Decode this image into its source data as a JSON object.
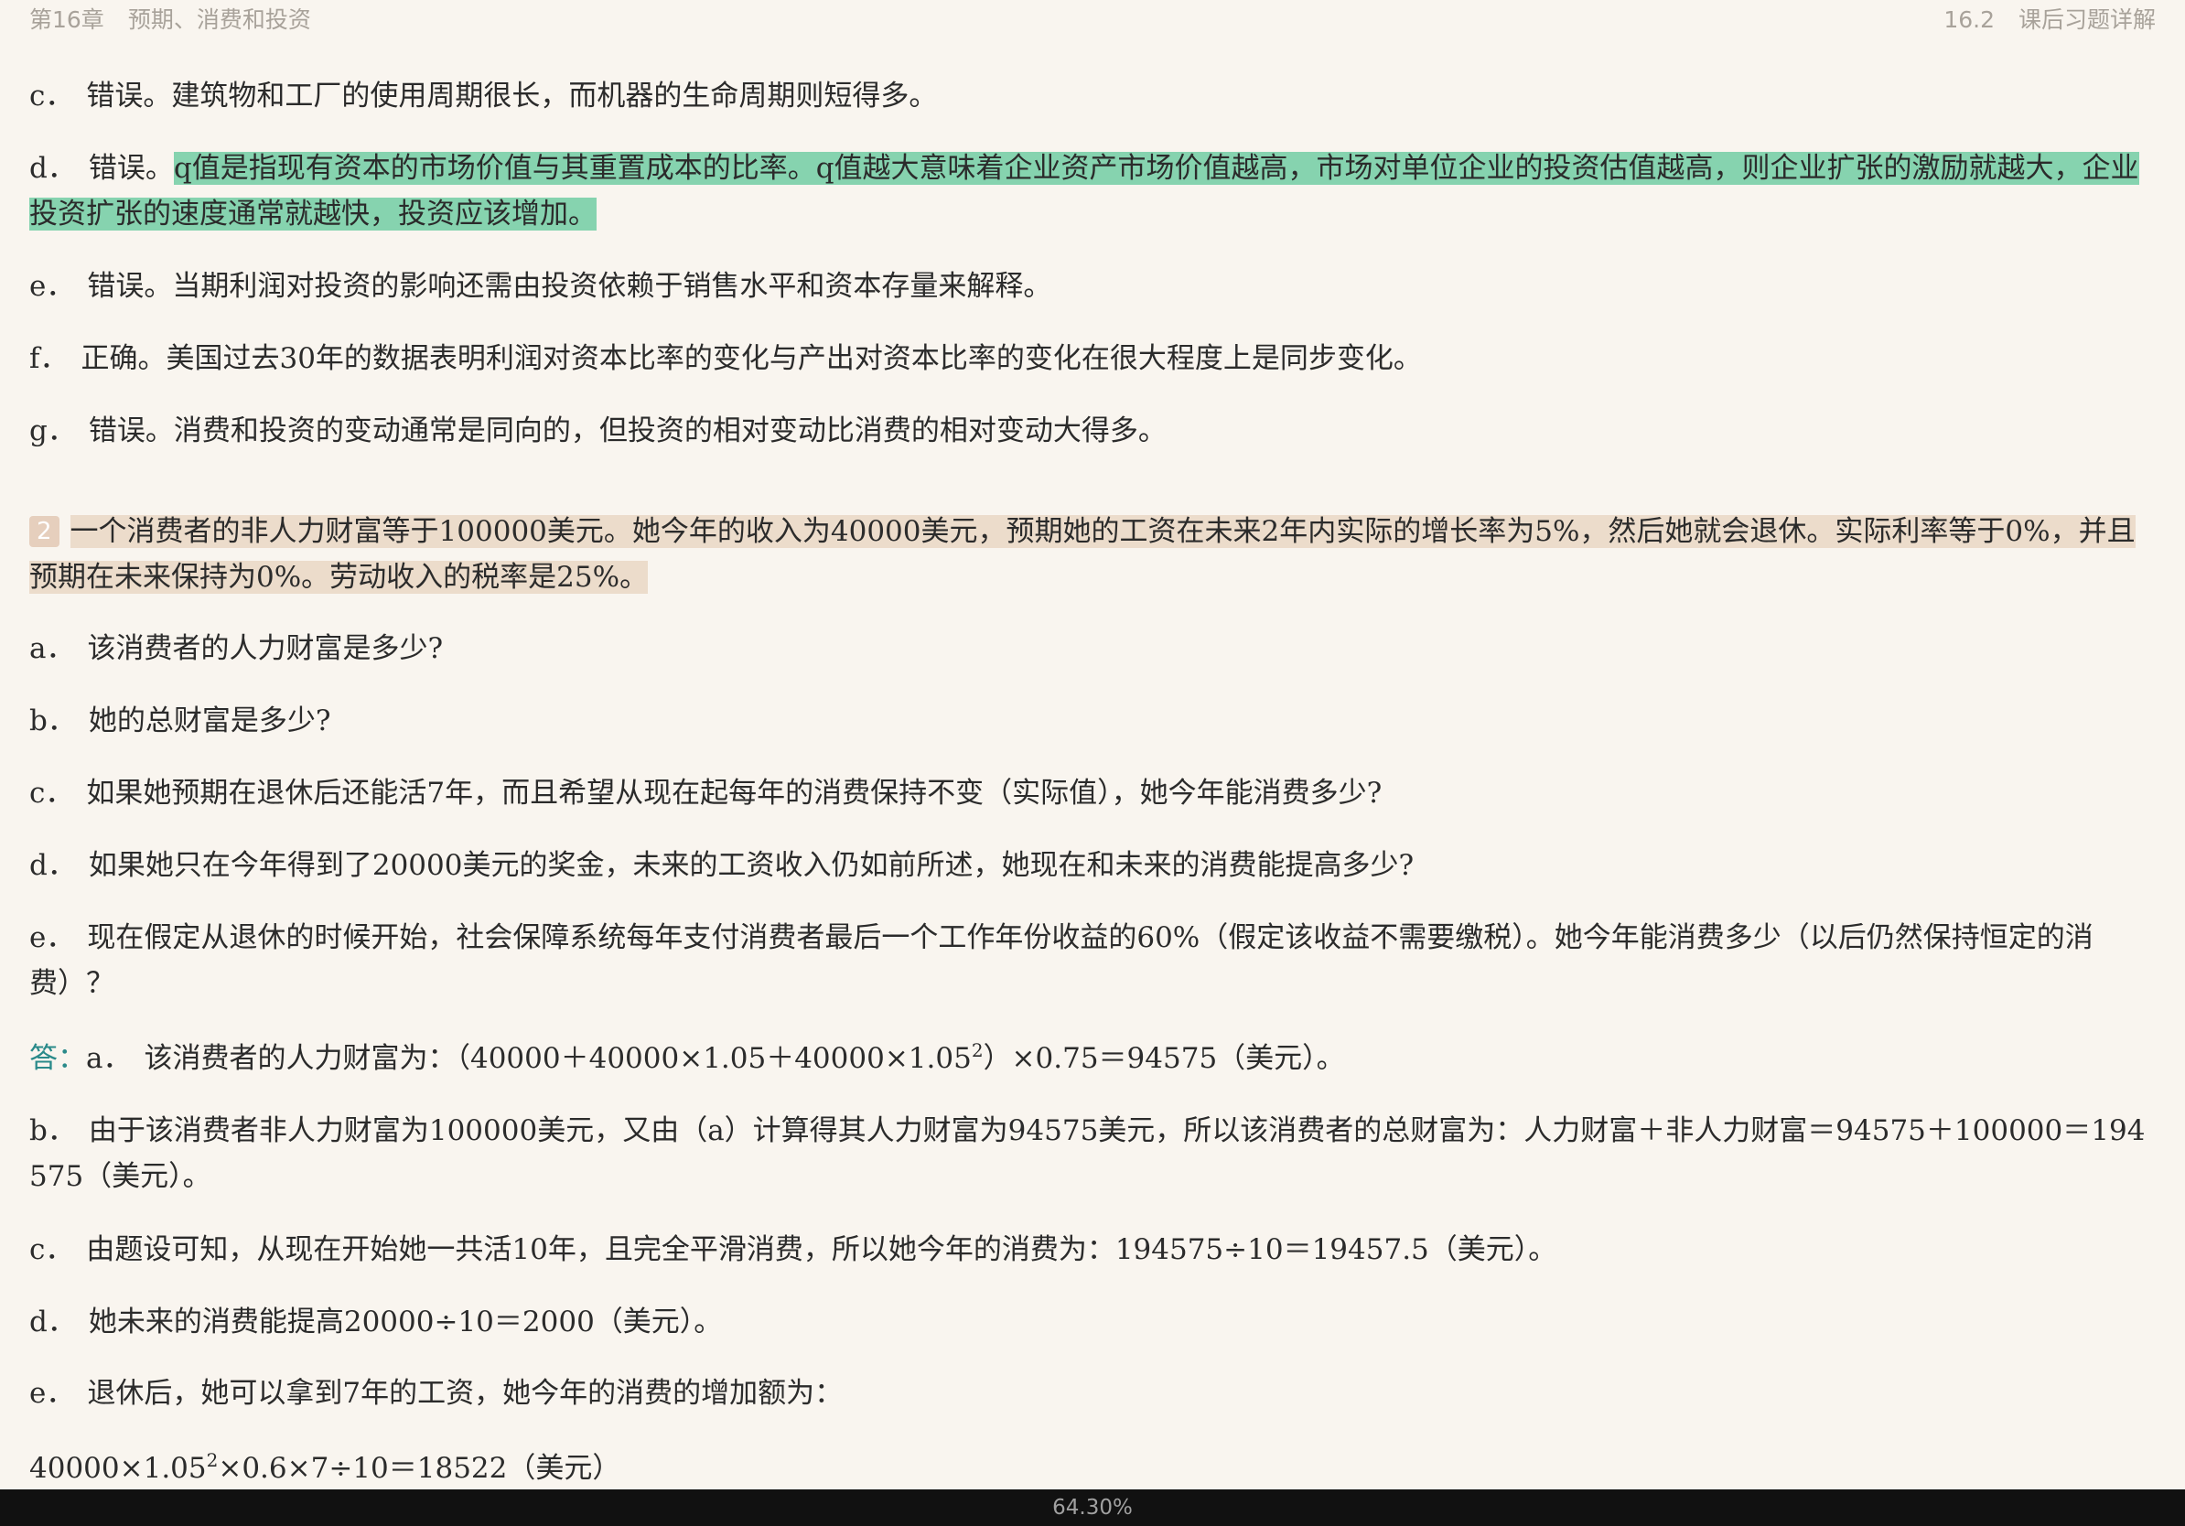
{
  "header": {
    "chapter": "第16章",
    "chapter_title": "预期、消费和投资",
    "section": "16.2",
    "section_title": "课后习题详解"
  },
  "items": {
    "c1": {
      "label": "c．",
      "text": "错误。建筑物和工厂的使用周期很长，而机器的生命周期则短得多。"
    },
    "d1": {
      "label": "d．",
      "prefix": "错误。",
      "highlight": "q值是指现有资本的市场价值与其重置成本的比率。q值越大意味着企业资产市场价值越高，市场对单位企业的投资估值越高，则企业扩张的激励就越大，企业投资扩张的速度通常就越快，投资应该增加。"
    },
    "e1": {
      "label": "e．",
      "text": "错误。当期利润对投资的影响还需由投资依赖于销售水平和资本存量来解释。"
    },
    "f1": {
      "label": "f．",
      "text": "正确。美国过去30年的数据表明利润对资本比率的变化与产出对资本比率的变化在很大程度上是同步变化。"
    },
    "g1": {
      "label": "g．",
      "text": "错误。消费和投资的变动通常是同向的，但投资的相对变动比消费的相对变动大得多。"
    }
  },
  "question2": {
    "number": "2",
    "text": "一个消费者的非人力财富等于100000美元。她今年的收入为40000美元，预期她的工资在未来2年内实际的增长率为5%，然后她就会退休。实际利率等于0%，并且预期在未来保持为0%。劳动收入的税率是25%。",
    "parts": {
      "a": {
        "label": "a．",
        "text": "该消费者的人力财富是多少?"
      },
      "b": {
        "label": "b．",
        "text": "她的总财富是多少?"
      },
      "c": {
        "label": "c．",
        "text": "如果她预期在退休后还能活7年，而且希望从现在起每年的消费保持不变（实际值），她今年能消费多少?"
      },
      "d": {
        "label": "d．",
        "text": "如果她只在今年得到了20000美元的奖金，未来的工资收入仍如前所述，她现在和未来的消费能提高多少?"
      },
      "e": {
        "label": "e．",
        "text": "现在假定从退休的时候开始，社会保障系统每年支付消费者最后一个工作年份收益的60%（假定该收益不需要缴税）。她今年能消费多少（以后仍然保持恒定的消费）？"
      }
    }
  },
  "answer": {
    "label": "答：",
    "a": {
      "label": "a．",
      "text_before": "该消费者的人力财富为：（40000＋40000×1.05＋40000×1.05",
      "sup": "2",
      "text_after": "）×0.75＝94575（美元）。"
    },
    "b": {
      "label": "b．",
      "text": "由于该消费者非人力财富为100000美元，又由（a）计算得其人力财富为94575美元，所以该消费者的总财富为：人力财富＋非人力财富＝94575＋100000＝194575（美元）。"
    },
    "c": {
      "label": "c．",
      "text": "由题设可知，从现在开始她一共活10年，且完全平滑消费，所以她今年的消费为：194575÷10＝19457.5（美元）。"
    },
    "d": {
      "label": "d．",
      "text": "她未来的消费能提高20000÷10＝2000（美元）。"
    },
    "e": {
      "label": "e．",
      "text": "退休后，她可以拿到7年的工资，她今年的消费的增加额为："
    },
    "formula": {
      "before": "40000×1.05",
      "sup": "2",
      "after": "×0.6×7÷10＝18522（美元）"
    }
  },
  "footer": {
    "progress": "64.30%"
  }
}
